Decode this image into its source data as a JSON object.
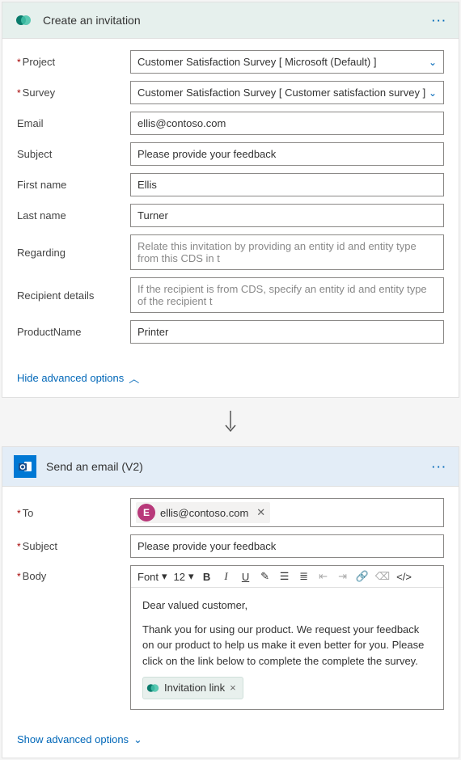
{
  "card1": {
    "title": "Create an invitation",
    "fields": {
      "project": {
        "label": "Project",
        "value": "Customer Satisfaction Survey [ Microsoft (Default) ]",
        "required": true
      },
      "survey": {
        "label": "Survey",
        "value": "Customer Satisfaction Survey [ Customer satisfaction survey ]",
        "required": true
      },
      "email": {
        "label": "Email",
        "value": "ellis@contoso.com"
      },
      "subject": {
        "label": "Subject",
        "value": "Please provide your feedback"
      },
      "firstname": {
        "label": "First name",
        "value": "Ellis"
      },
      "lastname": {
        "label": "Last name",
        "value": "Turner"
      },
      "regarding": {
        "label": "Regarding",
        "placeholder": "Relate this invitation by providing an entity id and entity type from this CDS in t"
      },
      "recipient": {
        "label": "Recipient details",
        "placeholder": "If the recipient is from CDS, specify an entity id and entity type of the recipient t"
      },
      "product": {
        "label": "ProductName",
        "value": "Printer"
      }
    },
    "hideAdv": "Hide advanced options"
  },
  "card2": {
    "title": "Send an email (V2)",
    "fields": {
      "to": {
        "label": "To",
        "required": true
      },
      "subject": {
        "label": "Subject",
        "value": "Please provide your feedback",
        "required": true
      },
      "body": {
        "label": "Body",
        "required": true
      }
    },
    "recipient": {
      "initial": "E",
      "email": "ellis@contoso.com"
    },
    "toolbar": {
      "font": "Font",
      "size": "12"
    },
    "bodyText": {
      "greeting": "Dear valued customer,",
      "para": "Thank you for using our product. We request your feedback on our product to help us make it even better for you. Please click on the link below to complete the complete the survey."
    },
    "invLink": "Invitation link",
    "showAdv": "Show advanced options"
  }
}
